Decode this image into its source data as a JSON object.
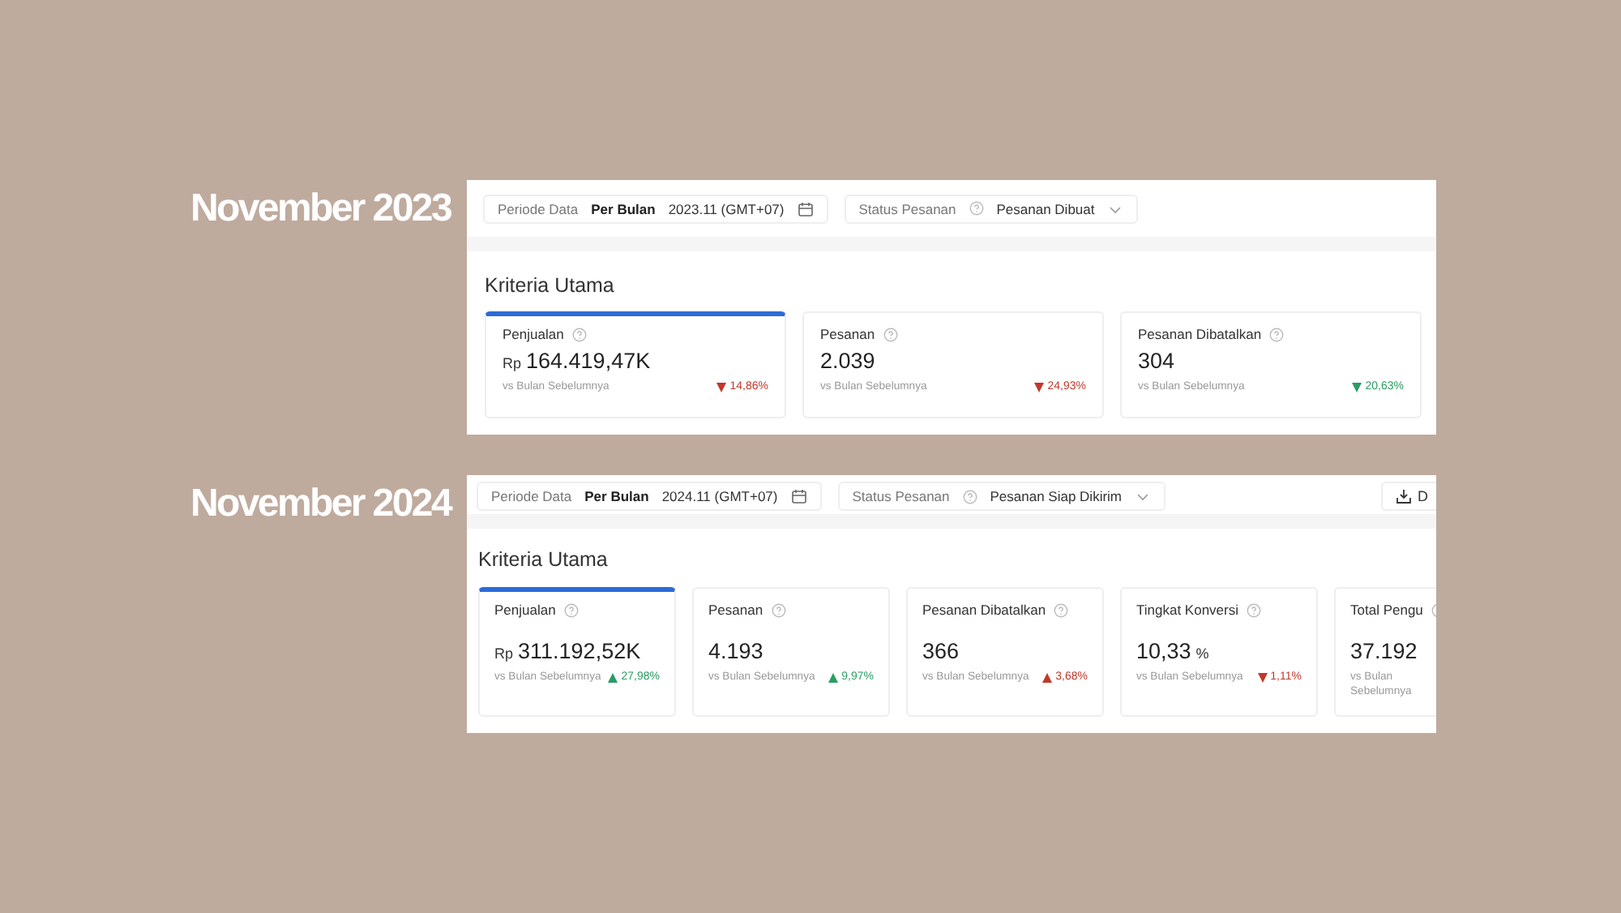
{
  "panels": [
    {
      "caption": "November 2023",
      "filters": [
        {
          "kind": "period",
          "label": "Periode Data",
          "mode": "Per Bulan",
          "value": "2023.11 (GMT+07)"
        },
        {
          "kind": "status",
          "label": "Status Pesanan",
          "value": "Pesanan Dibuat"
        }
      ],
      "section_title": "Kriteria Utama",
      "metrics": [
        {
          "label": "Penjualan",
          "prefix": "Rp",
          "value": "164.419,47K",
          "compare": "vs Bulan Sebelumnya",
          "change": "14,86%",
          "increase": false,
          "positive": false,
          "selected": true
        },
        {
          "label": "Pesanan",
          "value": "2.039",
          "compare": "vs Bulan Sebelumnya",
          "change": "24,93%",
          "increase": false,
          "positive": false,
          "selected": false
        },
        {
          "label": "Pesanan Dibatalkan",
          "value": "304",
          "compare": "vs Bulan Sebelumnya",
          "change": "20,63%",
          "increase": false,
          "positive": true,
          "selected": false
        }
      ]
    },
    {
      "caption": "November 2024",
      "filters": [
        {
          "kind": "period",
          "label": "Periode Data",
          "mode": "Per Bulan",
          "value": "2024.11 (GMT+07)"
        },
        {
          "kind": "status",
          "label": "Status Pesanan",
          "value": "Pesanan Siap Dikirim"
        }
      ],
      "download_label": "D",
      "section_title": "Kriteria Utama",
      "metrics": [
        {
          "label": "Penjualan",
          "prefix": "Rp",
          "value": "311.192,52K",
          "compare": "vs Bulan Sebelumnya",
          "change": "27,98%",
          "increase": true,
          "positive": true,
          "selected": true
        },
        {
          "label": "Pesanan",
          "value": "4.193",
          "compare": "vs Bulan Sebelumnya",
          "change": "9,97%",
          "increase": true,
          "positive": true,
          "selected": false
        },
        {
          "label": "Pesanan Dibatalkan",
          "value": "366",
          "compare": "vs Bulan Sebelumnya",
          "change": "3,68%",
          "increase": true,
          "positive": false,
          "selected": false
        },
        {
          "label": "Tingkat Konversi",
          "value": "10,33",
          "suffix": "%",
          "compare": "vs Bulan Sebelumnya",
          "change": "1,11%",
          "increase": false,
          "positive": false,
          "selected": false
        },
        {
          "label": "Total Pengu",
          "value": "37.192",
          "compare": "vs Bulan Sebelumnya",
          "selected": false
        }
      ]
    }
  ]
}
